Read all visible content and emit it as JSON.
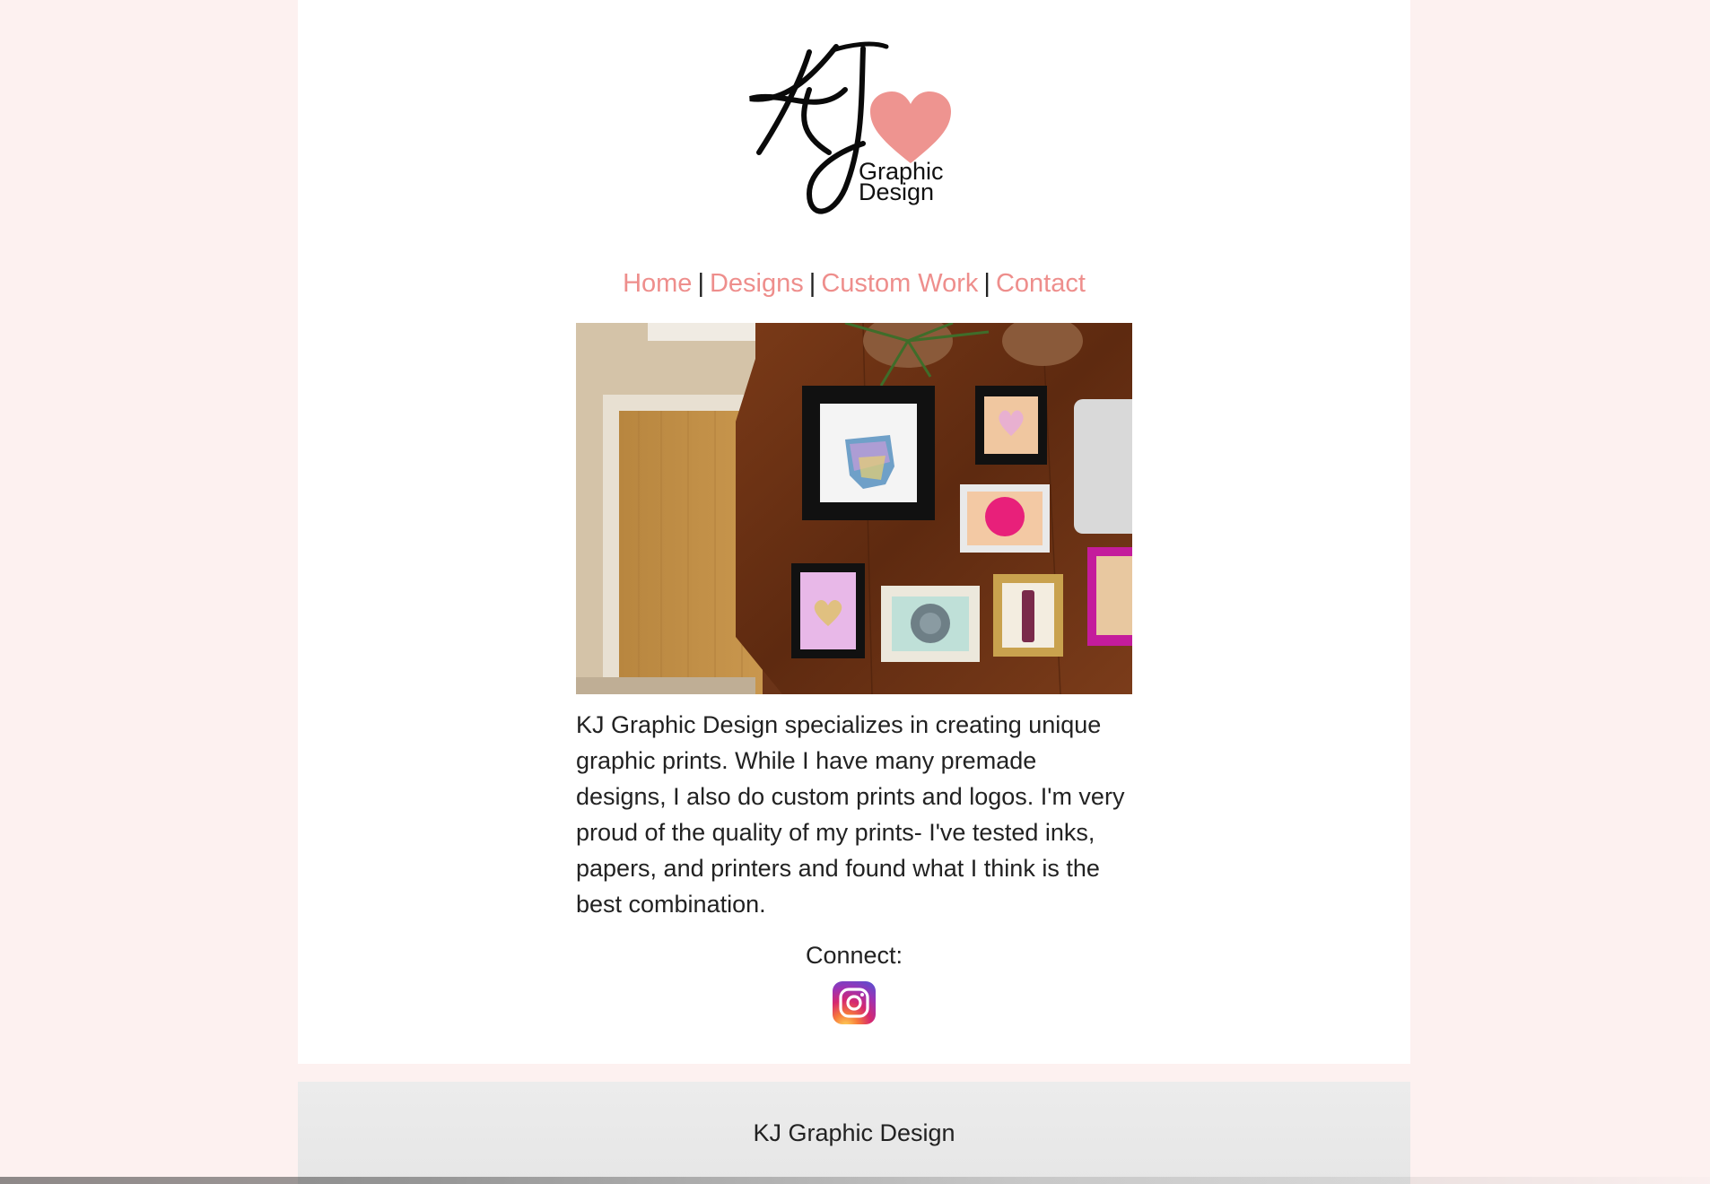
{
  "colors": {
    "page_background": "#fdf1f0",
    "card_background": "#ffffff",
    "nav_link": "#ee8e8c",
    "text": "#222222",
    "footer_background": "#ececec",
    "logo_heart": "#ee9490"
  },
  "logo": {
    "initials": "KJ",
    "line1": "Graphic",
    "line2": "Design",
    "icon": "heart-icon"
  },
  "nav": {
    "items": [
      {
        "label": "Home"
      },
      {
        "label": "Designs"
      },
      {
        "label": "Custom Work"
      },
      {
        "label": "Contact"
      }
    ],
    "separator": "|"
  },
  "hero": {
    "image": "framed-prints-on-wooden-table-photo"
  },
  "intro": {
    "text": "KJ Graphic Design specializes in creating unique graphic prints. While I have many premade designs, I also do custom prints and logos. I'm very proud of the quality of my prints- I've tested inks, papers, and printers and found what I think is the best combination."
  },
  "connect": {
    "label": "Connect:",
    "icon": "instagram-icon"
  },
  "footer": {
    "text": "KJ Graphic Design"
  }
}
